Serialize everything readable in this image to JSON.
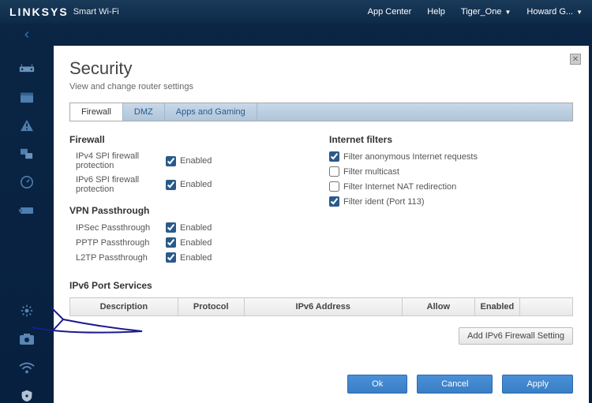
{
  "brand": {
    "name": "LINKSYS",
    "product": "Smart Wi-Fi"
  },
  "topnav": {
    "appcenter": "App Center",
    "help": "Help",
    "network": "Tiger_One",
    "user": "Howard G..."
  },
  "page": {
    "title": "Security",
    "subtitle": "View and change router settings"
  },
  "tabs": {
    "firewall": "Firewall",
    "dmz": "DMZ",
    "apps": "Apps and Gaming"
  },
  "firewall": {
    "heading": "Firewall",
    "ipv4_label": "IPv4 SPI firewall protection",
    "ipv6_label": "IPv6 SPI firewall protection",
    "enabled": "Enabled"
  },
  "vpn": {
    "heading": "VPN Passthrough",
    "ipsec": "IPSec Passthrough",
    "pptp": "PPTP Passthrough",
    "l2tp": "L2TP Passthrough"
  },
  "filters": {
    "heading": "Internet filters",
    "anon": "Filter anonymous Internet requests",
    "multicast": "Filter multicast",
    "nat": "Filter Internet NAT redirection",
    "ident": "Filter ident (Port 113)"
  },
  "ipv6": {
    "heading": "IPv6 Port Services",
    "cols": {
      "desc": "Description",
      "proto": "Protocol",
      "addr": "IPv6 Address",
      "allow": "Allow",
      "enabled": "Enabled"
    },
    "add": "Add IPv6 Firewall Setting"
  },
  "buttons": {
    "ok": "Ok",
    "cancel": "Cancel",
    "apply": "Apply"
  },
  "states": {
    "ipv4_spi": true,
    "ipv6_spi": true,
    "ipsec": true,
    "pptp": true,
    "l2tp": true,
    "anon": true,
    "multicast": false,
    "nat": false,
    "ident": true
  }
}
